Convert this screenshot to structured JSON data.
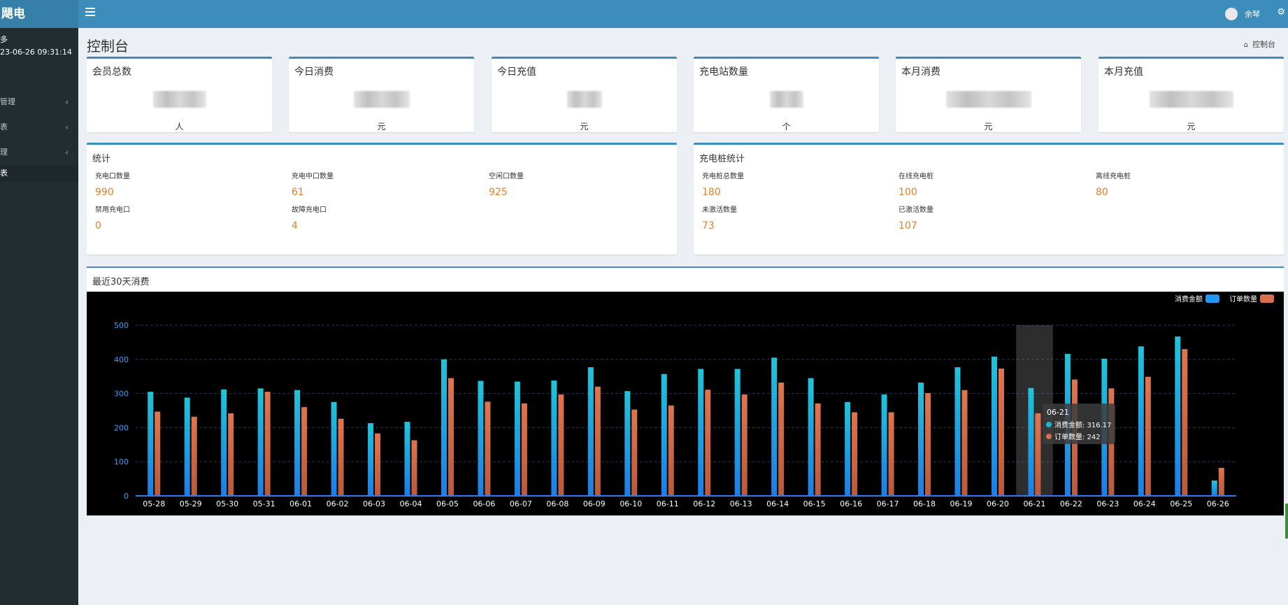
{
  "sidebar": {
    "brand": "飓电",
    "user_name": "多",
    "login_time": "23-06-26 09:31:14",
    "items": [
      {
        "label": "管理",
        "has_chevron": true
      },
      {
        "label": "表",
        "has_chevron": true
      },
      {
        "label": "理",
        "has_chevron": true
      },
      {
        "label": "表",
        "has_chevron": false,
        "active": true
      }
    ]
  },
  "header": {
    "menu_icon": "hamburger-icon",
    "username": "余琴",
    "settings_icon": "gears-icon"
  },
  "page": {
    "title": "控制台",
    "breadcrumb_icon": "home-icon",
    "breadcrumb": "控制台"
  },
  "summary_cards": [
    {
      "title": "会员总数",
      "unit": "人"
    },
    {
      "title": "今日消费",
      "unit": "元"
    },
    {
      "title": "今日充值",
      "unit": "元"
    },
    {
      "title": "充电站数量",
      "unit": "个"
    },
    {
      "title": "本月消费",
      "unit": "元"
    },
    {
      "title": "本月充值",
      "unit": "元"
    }
  ],
  "port_stats": {
    "title": "统计",
    "items": [
      {
        "label": "充电口数量",
        "value": "990"
      },
      {
        "label": "充电中口数量",
        "value": "61"
      },
      {
        "label": "空闲口数量",
        "value": "925"
      },
      {
        "label": "禁用充电口",
        "value": "0"
      },
      {
        "label": "故障充电口",
        "value": "4"
      }
    ]
  },
  "pile_stats": {
    "title": "充电桩统计",
    "items": [
      {
        "label": "充电桩总数量",
        "value": "180"
      },
      {
        "label": "在线充电桩",
        "value": "100"
      },
      {
        "label": "离线充电桩",
        "value": "80"
      },
      {
        "label": "未激活数量",
        "value": "73"
      },
      {
        "label": "已激活数量",
        "value": "107"
      }
    ]
  },
  "chart_title": "最近30天消费",
  "chart_data": {
    "type": "bar",
    "categories": [
      "05-28",
      "05-29",
      "05-30",
      "05-31",
      "06-01",
      "06-02",
      "06-03",
      "06-04",
      "06-05",
      "06-06",
      "06-07",
      "06-08",
      "06-09",
      "06-10",
      "06-11",
      "06-12",
      "06-13",
      "06-14",
      "06-15",
      "06-16",
      "06-17",
      "06-18",
      "06-19",
      "06-20",
      "06-21",
      "06-22",
      "06-23",
      "06-24",
      "06-25",
      "06-26"
    ],
    "series": [
      {
        "name": "消费金额",
        "color": "#1fb6d6",
        "values": [
          305,
          288,
          312,
          315,
          310,
          275,
          213,
          217,
          400,
          337,
          335,
          338,
          377,
          307,
          357,
          372,
          372,
          405,
          345,
          275,
          297,
          332,
          377,
          408,
          316.17,
          416,
          402,
          438,
          467,
          45
        ]
      },
      {
        "name": "订单数量",
        "color": "#d8704f",
        "values": [
          247,
          232,
          242,
          305,
          260,
          226,
          183,
          163,
          345,
          276,
          271,
          297,
          320,
          253,
          265,
          311,
          297,
          332,
          271,
          245,
          245,
          301,
          310,
          373,
          242,
          341,
          315,
          349,
          430,
          82
        ]
      }
    ],
    "ylim": [
      0,
      500
    ],
    "yticks": [
      0,
      100,
      200,
      300,
      400,
      500
    ],
    "grid": true,
    "legend": "top-right",
    "tooltip": {
      "category": "06-21",
      "rows": [
        {
          "label": "消费金额",
          "value": "316.17"
        },
        {
          "label": "订单数量",
          "value": "242"
        }
      ]
    }
  }
}
